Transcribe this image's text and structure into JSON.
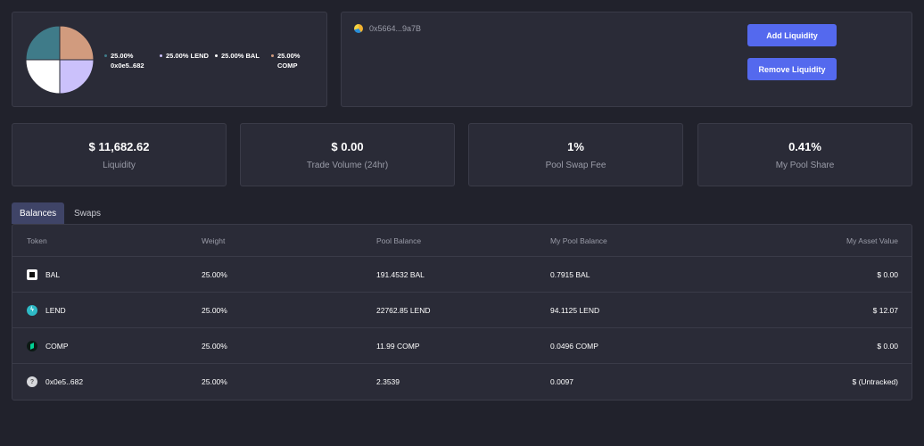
{
  "colors": {
    "accent": "#5469ee",
    "pie": [
      "#d19b7e",
      "#cbc1fb",
      "#ffffff",
      "#3f7b89"
    ]
  },
  "pool": {
    "legend": [
      {
        "label": "25.00% 0x0e5..682",
        "color": "#3f7b89"
      },
      {
        "label": "25.00% LEND",
        "color": "#cbc1fb"
      },
      {
        "label": "25.00% BAL",
        "color": "#ffffff"
      },
      {
        "label": "25.00% COMP",
        "color": "#d19b7e"
      }
    ],
    "pie_shares": [
      25,
      25,
      25,
      25
    ]
  },
  "actions": {
    "address": "0x5664...9a7B",
    "add_label": "Add Liquidity",
    "remove_label": "Remove Liquidity"
  },
  "stats": [
    {
      "value": "$ 11,682.62",
      "label": "Liquidity"
    },
    {
      "value": "$ 0.00",
      "label": "Trade Volume (24hr)"
    },
    {
      "value": "1%",
      "label": "Pool Swap Fee"
    },
    {
      "value": "0.41%",
      "label": "My Pool Share"
    }
  ],
  "tabs": [
    {
      "label": "Balances",
      "active": true
    },
    {
      "label": "Swaps",
      "active": false
    }
  ],
  "table": {
    "headers": [
      "Token",
      "Weight",
      "Pool Balance",
      "My Pool Balance",
      "My Asset Value"
    ],
    "rows": [
      {
        "icon": "bal-token-icon",
        "token": "BAL",
        "weight": "25.00%",
        "pool_balance": "191.4532 BAL",
        "my_balance": "0.7915 BAL",
        "value": "$ 0.00"
      },
      {
        "icon": "lend-token-icon",
        "token": "LEND",
        "weight": "25.00%",
        "pool_balance": "22762.85 LEND",
        "my_balance": "94.1125 LEND",
        "value": "$ 12.07"
      },
      {
        "icon": "comp-token-icon",
        "token": "COMP",
        "weight": "25.00%",
        "pool_balance": "11.99 COMP",
        "my_balance": "0.0496 COMP",
        "value": "$ 0.00"
      },
      {
        "icon": "unknown-token-icon",
        "token": "0x0e5..682",
        "weight": "25.00%",
        "pool_balance": "2.3539",
        "my_balance": "0.0097",
        "value": "$ (Untracked)"
      }
    ]
  }
}
